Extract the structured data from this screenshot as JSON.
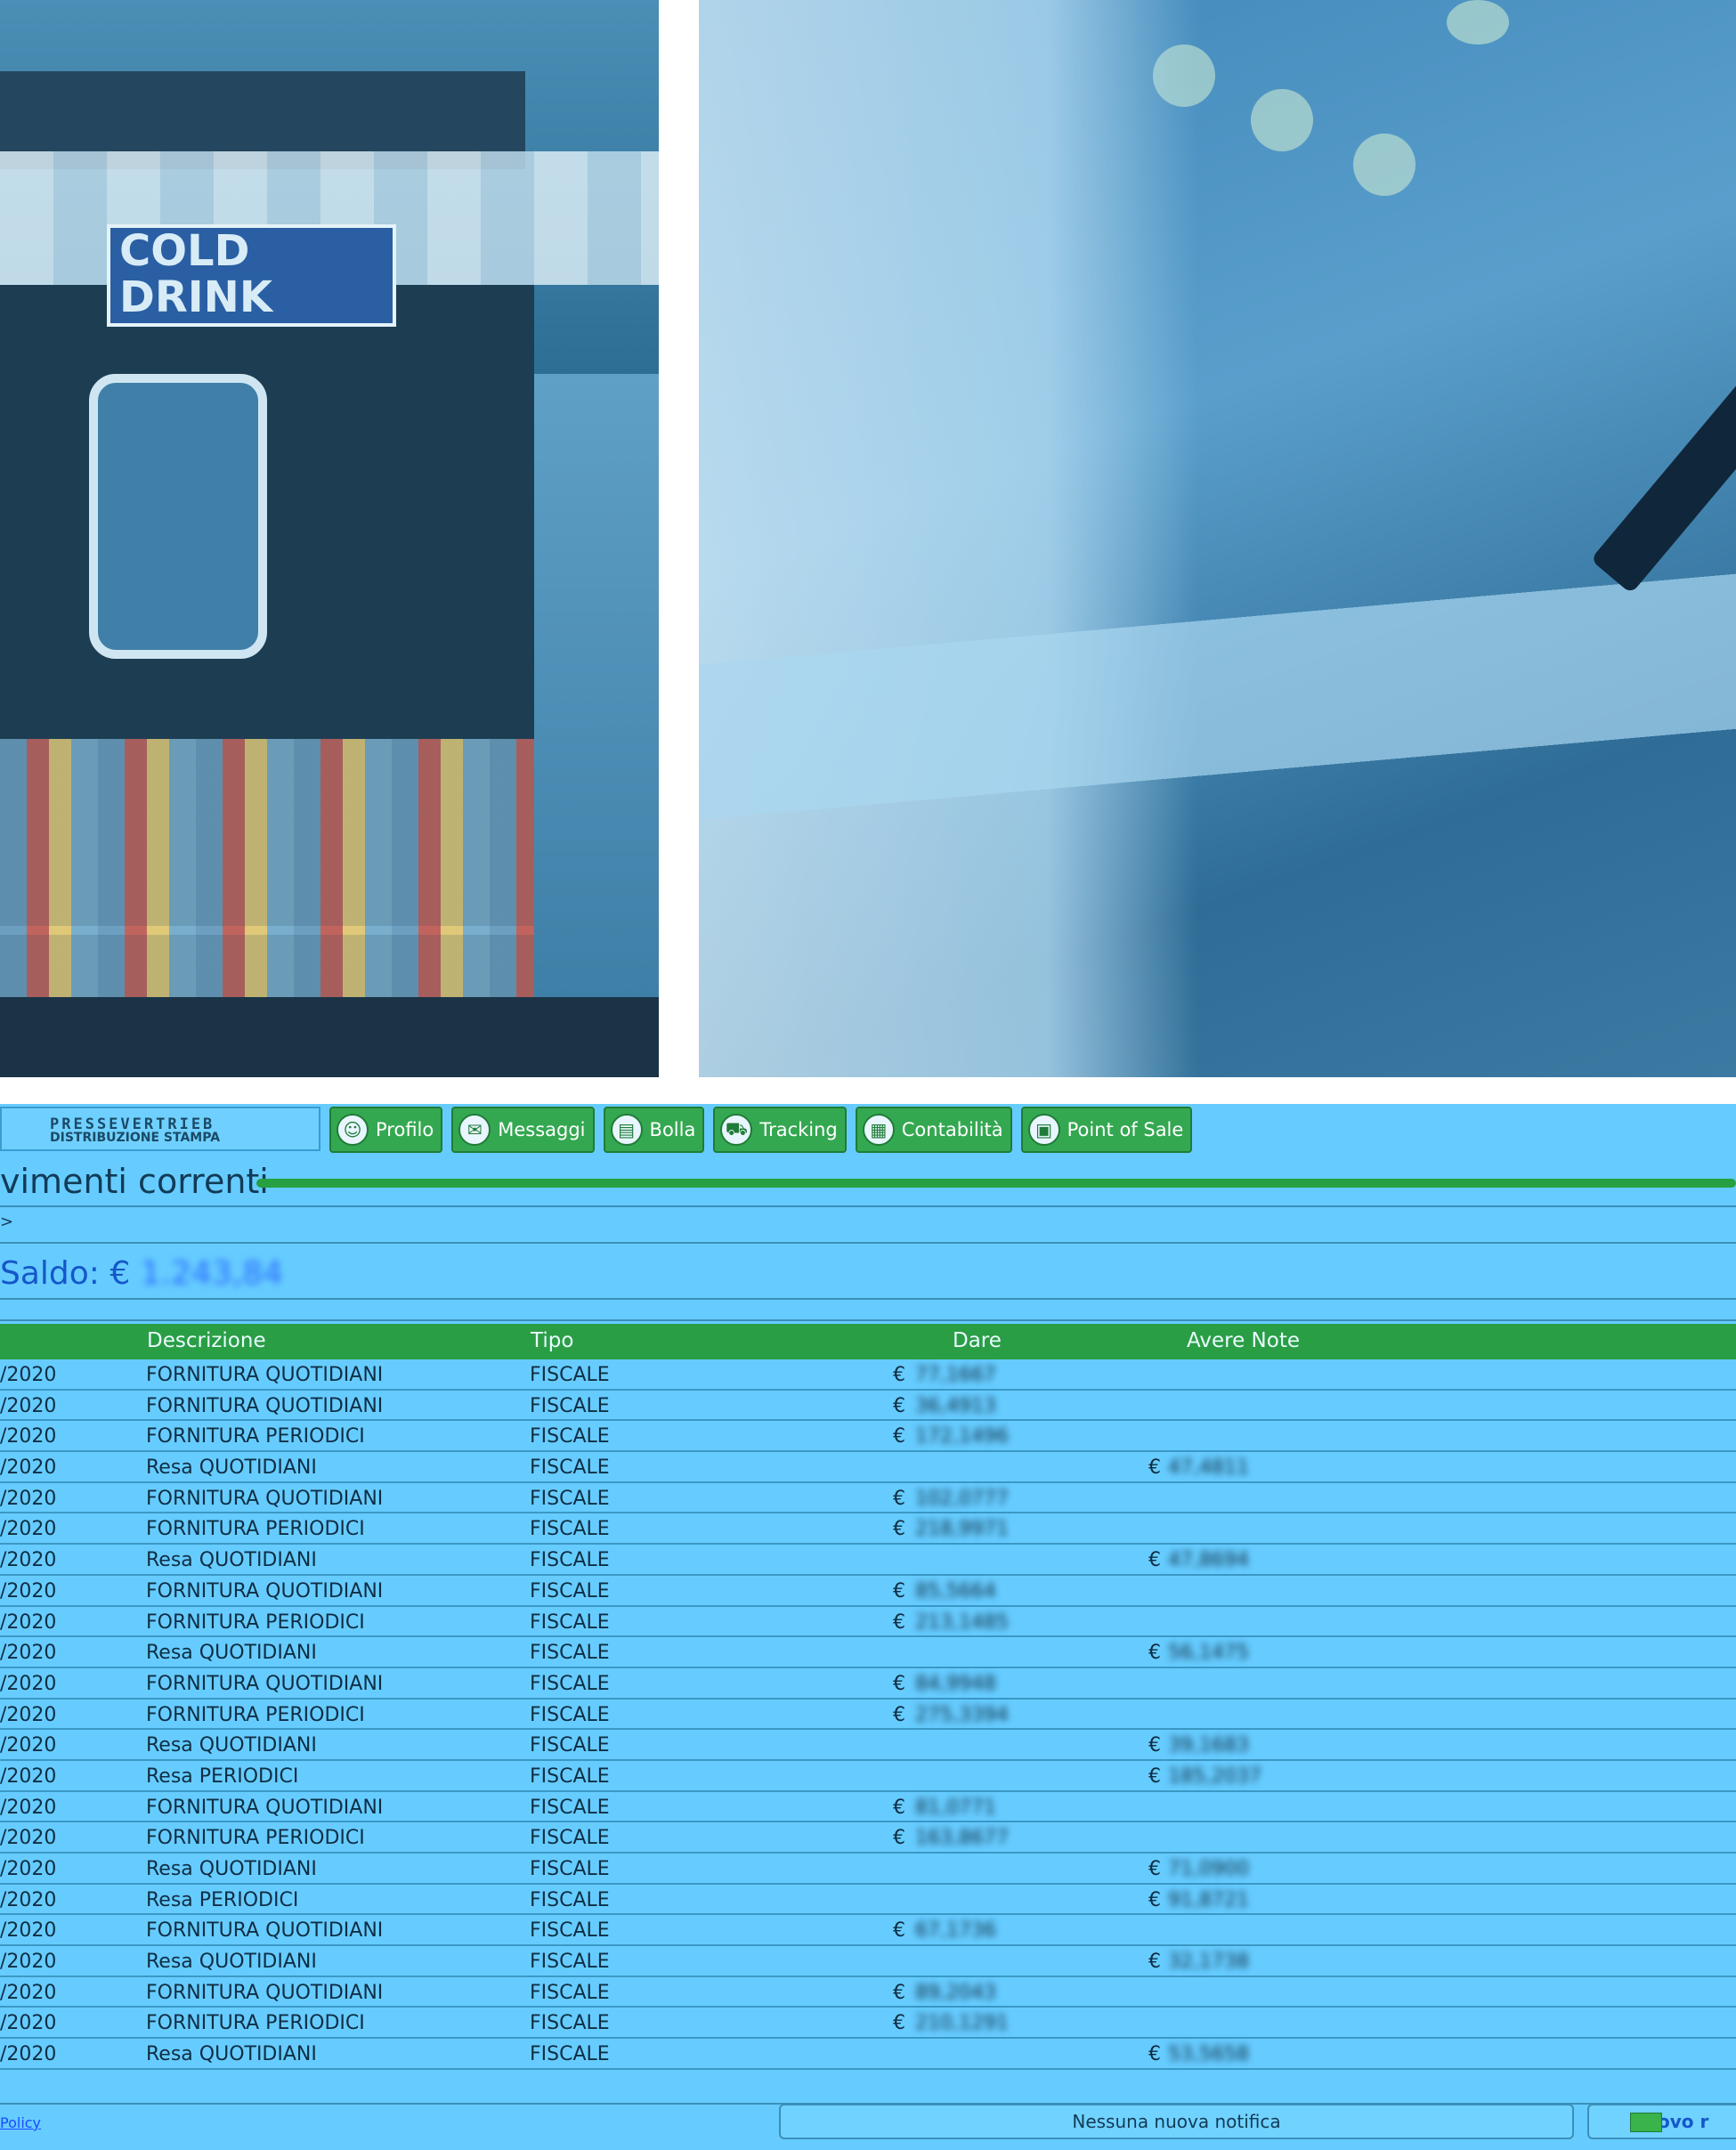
{
  "hero": {
    "kiosk_sign_line1": "COLD",
    "kiosk_sign_line2": "DRINK"
  },
  "header": {
    "logo_line1": "PRESSEVERTRIEB",
    "logo_line2": "DISTRIBUZIONE STAMPA"
  },
  "nav": [
    {
      "label": "Profilo",
      "icon": "person-icon"
    },
    {
      "label": "Messaggi",
      "icon": "message-icon"
    },
    {
      "label": "Bolla",
      "icon": "document-icon"
    },
    {
      "label": "Tracking",
      "icon": "truck-icon"
    },
    {
      "label": "Contabilità",
      "icon": "calculator-icon"
    },
    {
      "label": "Point of Sale",
      "icon": "register-icon"
    }
  ],
  "page": {
    "title": "vimenti correnti",
    "breadcrumb": ">",
    "saldo_label": "Saldo: €",
    "saldo_value": "1.243,84"
  },
  "table": {
    "headers": {
      "descrizione": "Descrizione",
      "tipo": "Tipo",
      "dare": "Dare",
      "avere_note": "Avere Note"
    },
    "rows": [
      {
        "date": "/2020",
        "desc": "FORNITURA QUOTIDIANI",
        "tipo": "FISCALE",
        "dare": "77,1667",
        "avere": ""
      },
      {
        "date": "/2020",
        "desc": "FORNITURA QUOTIDIANI",
        "tipo": "FISCALE",
        "dare": "36,4913",
        "avere": ""
      },
      {
        "date": "/2020",
        "desc": "FORNITURA PERIODICI",
        "tipo": "FISCALE",
        "dare": "172,1496",
        "avere": ""
      },
      {
        "date": "/2020",
        "desc": "Resa QUOTIDIANI",
        "tipo": "FISCALE",
        "dare": "",
        "avere": "47,4811"
      },
      {
        "date": "/2020",
        "desc": "FORNITURA QUOTIDIANI",
        "tipo": "FISCALE",
        "dare": "102,0777",
        "avere": ""
      },
      {
        "date": "/2020",
        "desc": "FORNITURA PERIODICI",
        "tipo": "FISCALE",
        "dare": "218,9971",
        "avere": ""
      },
      {
        "date": "/2020",
        "desc": "Resa QUOTIDIANI",
        "tipo": "FISCALE",
        "dare": "",
        "avere": "47,8694"
      },
      {
        "date": "/2020",
        "desc": "FORNITURA QUOTIDIANI",
        "tipo": "FISCALE",
        "dare": "85,5664",
        "avere": ""
      },
      {
        "date": "/2020",
        "desc": "FORNITURA PERIODICI",
        "tipo": "FISCALE",
        "dare": "213,1485",
        "avere": ""
      },
      {
        "date": "/2020",
        "desc": "Resa QUOTIDIANI",
        "tipo": "FISCALE",
        "dare": "",
        "avere": "56,1475"
      },
      {
        "date": "/2020",
        "desc": "FORNITURA QUOTIDIANI",
        "tipo": "FISCALE",
        "dare": "84,9948",
        "avere": ""
      },
      {
        "date": "/2020",
        "desc": "FORNITURA PERIODICI",
        "tipo": "FISCALE",
        "dare": "275,3394",
        "avere": ""
      },
      {
        "date": "/2020",
        "desc": "Resa QUOTIDIANI",
        "tipo": "FISCALE",
        "dare": "",
        "avere": "39,1683"
      },
      {
        "date": "/2020",
        "desc": "Resa PERIODICI",
        "tipo": "FISCALE",
        "dare": "",
        "avere": "185,2037"
      },
      {
        "date": "/2020",
        "desc": "FORNITURA QUOTIDIANI",
        "tipo": "FISCALE",
        "dare": "81,0771",
        "avere": ""
      },
      {
        "date": "/2020",
        "desc": "FORNITURA PERIODICI",
        "tipo": "FISCALE",
        "dare": "163,8677",
        "avere": ""
      },
      {
        "date": "/2020",
        "desc": "Resa QUOTIDIANI",
        "tipo": "FISCALE",
        "dare": "",
        "avere": "71,0900"
      },
      {
        "date": "/2020",
        "desc": "Resa PERIODICI",
        "tipo": "FISCALE",
        "dare": "",
        "avere": "91,8721"
      },
      {
        "date": "/2020",
        "desc": "FORNITURA QUOTIDIANI",
        "tipo": "FISCALE",
        "dare": "67,1736",
        "avere": ""
      },
      {
        "date": "/2020",
        "desc": "Resa QUOTIDIANI",
        "tipo": "FISCALE",
        "dare": "",
        "avere": "32,1738"
      },
      {
        "date": "/2020",
        "desc": "FORNITURA QUOTIDIANI",
        "tipo": "FISCALE",
        "dare": "89,2043",
        "avere": ""
      },
      {
        "date": "/2020",
        "desc": "FORNITURA PERIODICI",
        "tipo": "FISCALE",
        "dare": "210,1291",
        "avere": ""
      },
      {
        "date": "/2020",
        "desc": "Resa QUOTIDIANI",
        "tipo": "FISCALE",
        "dare": "",
        "avere": "53,5658"
      }
    ]
  },
  "footer": {
    "policy": "Policy",
    "notification": "Nessuna nuova notifica",
    "new_button": "Nuovo r"
  }
}
